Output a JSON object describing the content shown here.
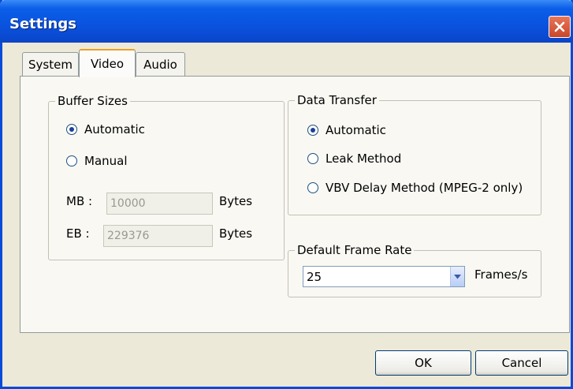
{
  "window": {
    "title": "Settings"
  },
  "tabs": [
    {
      "label": "System",
      "active": false
    },
    {
      "label": "Video",
      "active": true
    },
    {
      "label": "Audio",
      "active": false
    }
  ],
  "buffer_sizes": {
    "label": "Buffer Sizes",
    "options": [
      {
        "label": "Automatic",
        "selected": true
      },
      {
        "label": "Manual",
        "selected": false
      }
    ],
    "mb": {
      "label": "MB :",
      "value": "10000",
      "unit": "Bytes"
    },
    "eb": {
      "label": "EB :",
      "value": "229376",
      "unit": "Bytes"
    }
  },
  "data_transfer": {
    "label": "Data Transfer",
    "options": [
      {
        "label": "Automatic",
        "selected": true
      },
      {
        "label": "Leak Method",
        "selected": false
      },
      {
        "label": "VBV Delay Method (MPEG-2 only)",
        "selected": false
      }
    ]
  },
  "frame_rate": {
    "label": "Default Frame Rate",
    "value": "25",
    "unit": "Frames/s"
  },
  "buttons": {
    "ok": "OK",
    "cancel": "Cancel"
  },
  "icons": {
    "close": "close-icon",
    "dropdown": "chevron-down-icon"
  },
  "colors": {
    "titlebar": "#0a54e0",
    "dialog_bg": "#ece9d8",
    "close_button": "#c8452a",
    "active_tab_accent": "#e6a02a"
  }
}
